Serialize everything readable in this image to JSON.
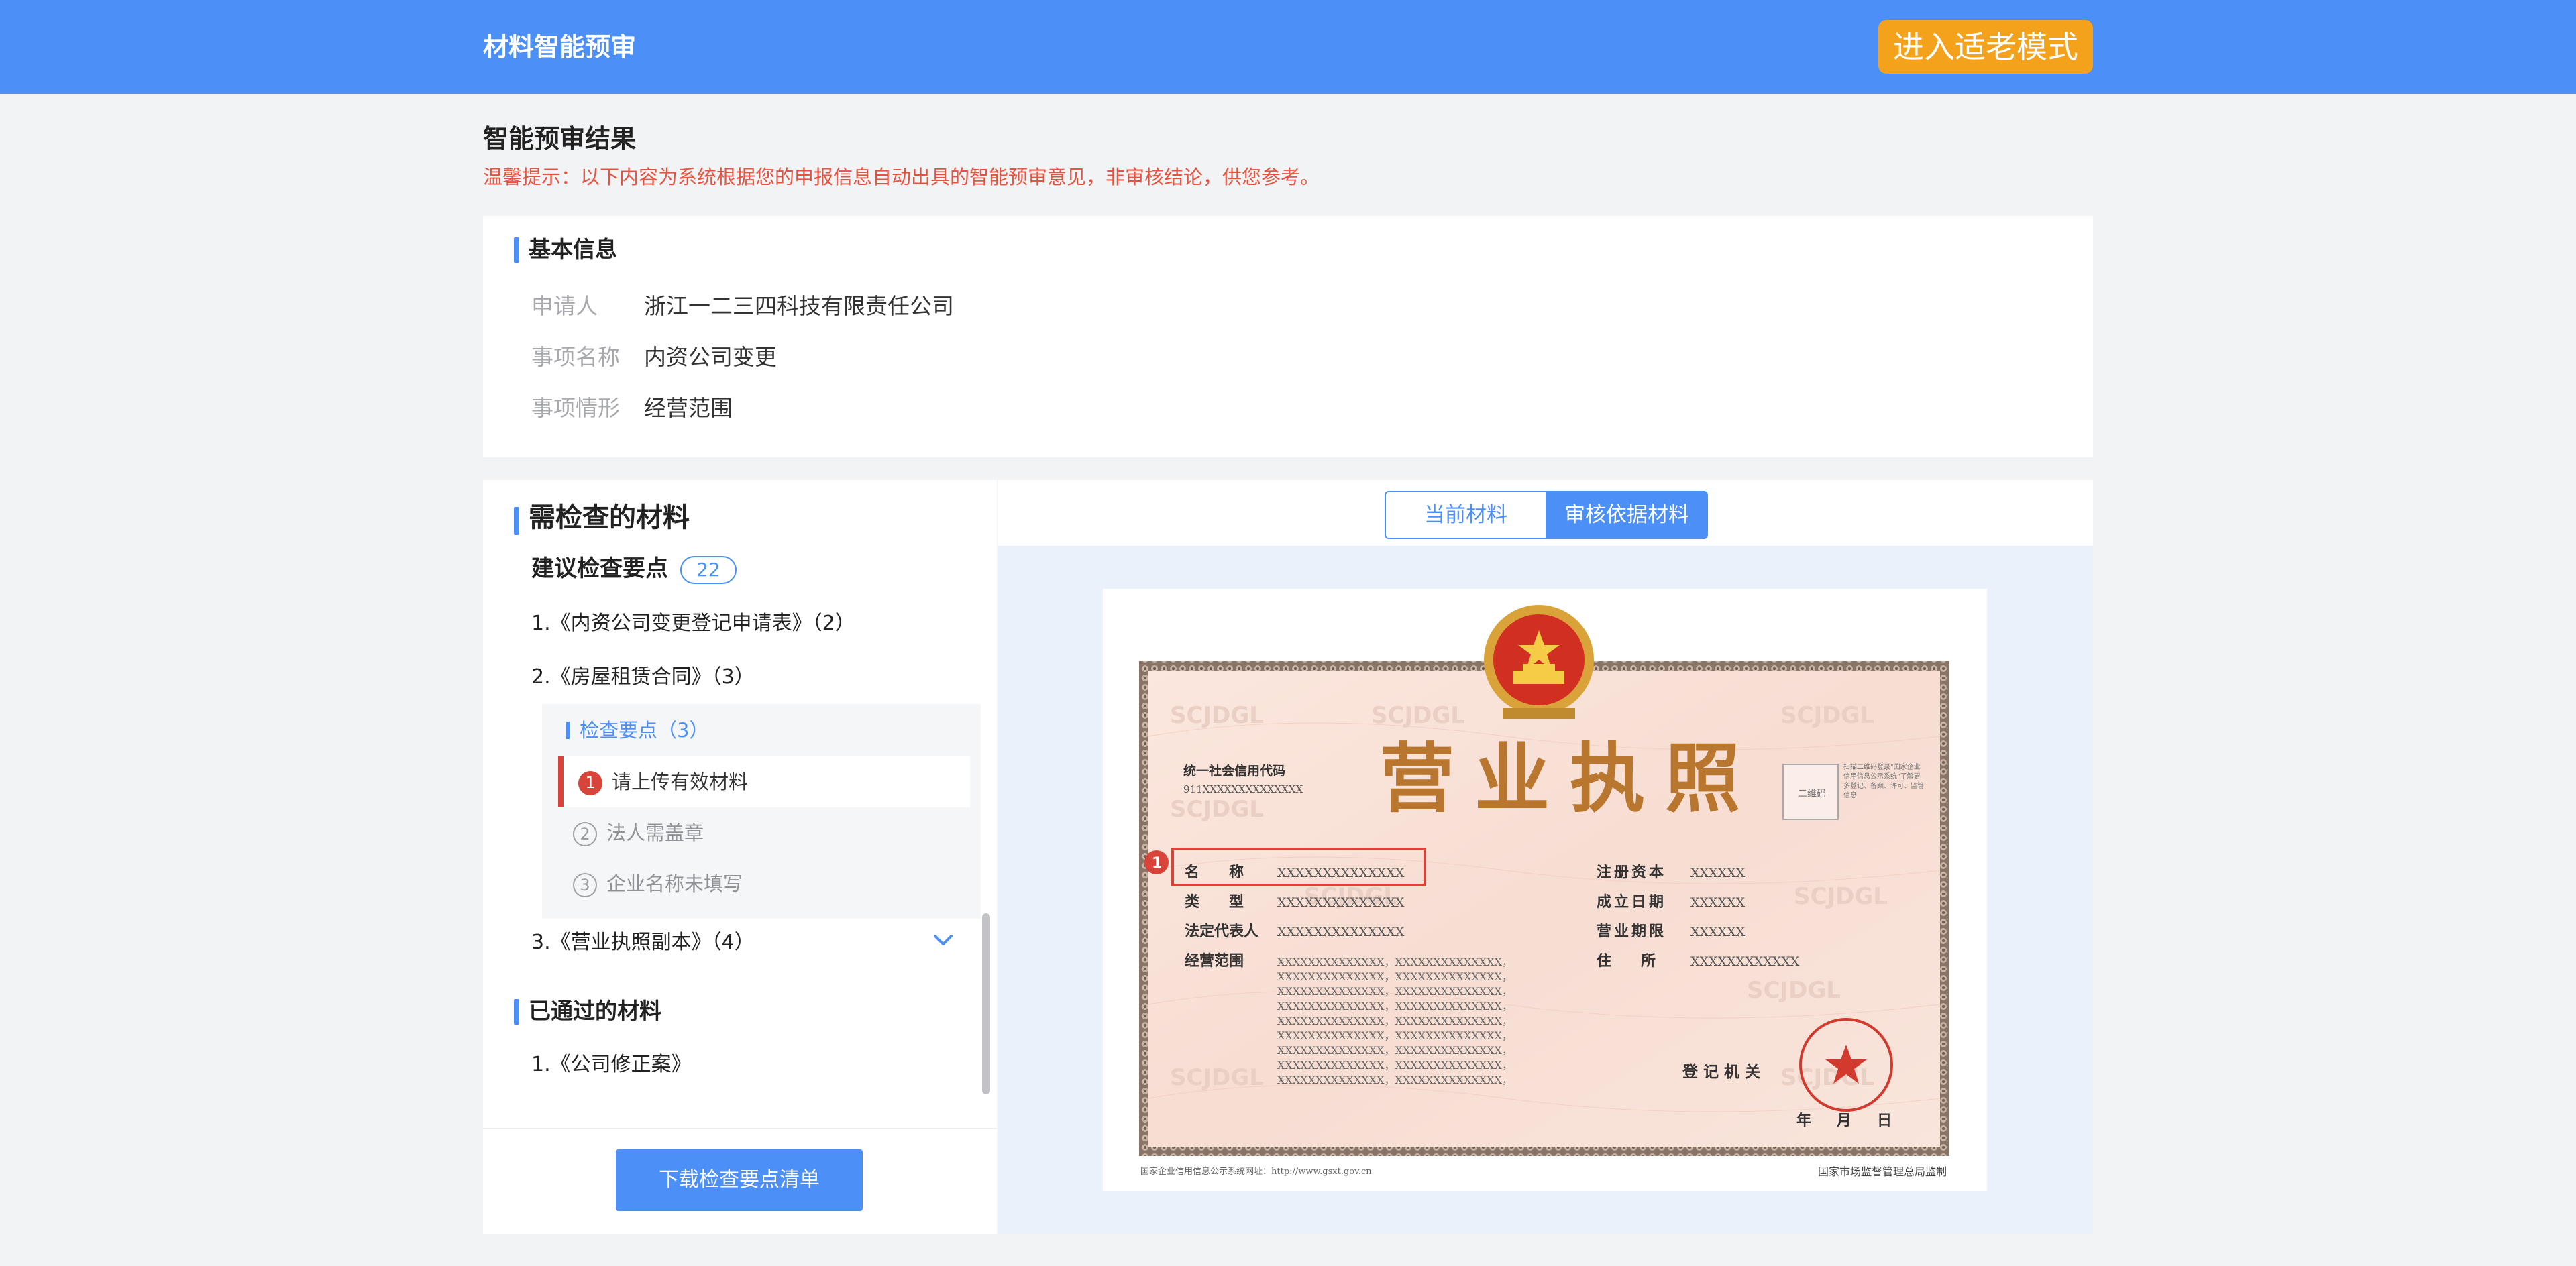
{
  "header": {
    "app_title": "材料智能预审",
    "elder_mode_button": "进入适老模式"
  },
  "result": {
    "title": "智能预审结果",
    "tip": "温馨提示：以下内容为系统根据您的申报信息自动出具的智能预审意见，非审核结论，供您参考。"
  },
  "basic_info": {
    "section_title": "基本信息",
    "rows": [
      {
        "label": "申请人",
        "value": "浙江一二三四科技有限责任公司"
      },
      {
        "label": "事项名称",
        "value": "内资公司变更"
      },
      {
        "label": "事项情形",
        "value": "经营范围"
      }
    ]
  },
  "materials": {
    "section_title": "需检查的材料",
    "suggest_label": "建议检查要点",
    "suggest_count": "22",
    "items": [
      {
        "label": "1.《内资公司变更登记申请表》（2）"
      },
      {
        "label": "2.《房屋租赁合同》（3）"
      },
      {
        "label": "3.《营业执照副本》（4）"
      }
    ],
    "check_points_title": "检查要点（3）",
    "check_points": [
      {
        "num": "1",
        "label": "请上传有效材料",
        "active": true
      },
      {
        "num": "2",
        "label": "法人需盖章",
        "active": false
      },
      {
        "num": "3",
        "label": "企业名称未填写",
        "active": false
      }
    ],
    "passed_title": "已通过的材料",
    "passed_items": [
      {
        "label": "1.《公司修正案》"
      }
    ],
    "download_button": "下载检查要点清单"
  },
  "viewer": {
    "tabs": [
      "当前材料",
      "审核依据材料"
    ],
    "active_tab": "审核依据材料",
    "license": {
      "title": "营业执照",
      "credit_code_label": "统一社会信用代码",
      "credit_code_value": "911XXXXXXXXXXXXXX",
      "qr_label": "二维码",
      "qr_note": "扫描二维码登录\"国家企业信用信息公示系统\"了解更多登记、备案、许可、监管信息",
      "watermark": "SCJDGL",
      "marker": "1",
      "left_fields": [
        {
          "label": "名　　称",
          "value": "XXXXXXXXXXXXXX"
        },
        {
          "label": "类　　型",
          "value": "XXXXXXXXXXXXXX"
        },
        {
          "label": "法定代表人",
          "value": "XXXXXXXXXXXXXX"
        }
      ],
      "scope_label": "经营范围",
      "scope_value": "XXXXXXXXXXXXXX，XXXXXXXXXXXXXX，",
      "right_fields": [
        {
          "label": "注册资本",
          "value": "XXXXXX"
        },
        {
          "label": "成立日期",
          "value": "XXXXXX"
        },
        {
          "label": "营业期限",
          "value": "XXXXXX"
        },
        {
          "label": "住　　所",
          "value": "XXXXXXXXXXXX"
        }
      ],
      "authority_label": "登记机关",
      "date_year": "年",
      "date_month": "月",
      "date_day": "日",
      "footer_left": "国家企业信用信息公示系统网址：http://www.gsxt.gov.cn",
      "footer_right": "国家市场监督管理总局监制"
    }
  },
  "colors": {
    "primary": "#4b8ff7",
    "warning": "#f4a11c",
    "danger": "#d8433a",
    "tip": "#e8523f"
  }
}
